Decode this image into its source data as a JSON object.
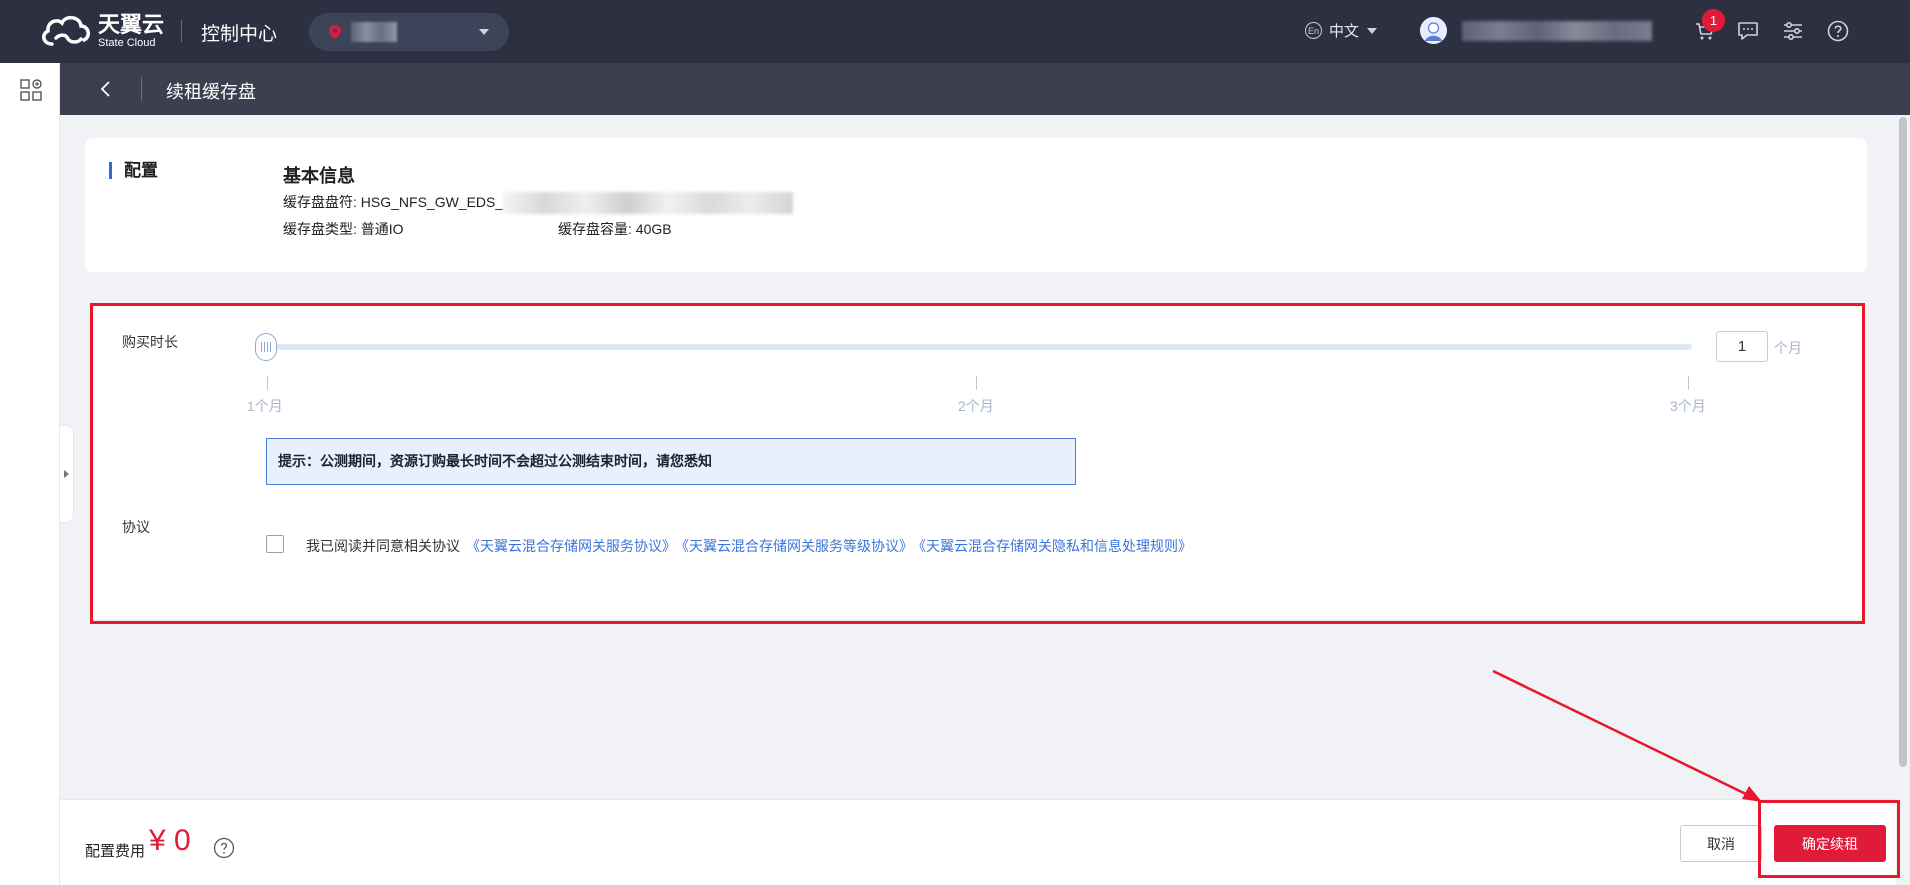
{
  "topbar": {
    "logo_cn": "天翼云",
    "logo_en": "State Cloud",
    "console_title": "控制中心",
    "language": "中文",
    "language_badge": "En",
    "cart_badge": "1"
  },
  "subbar": {
    "title": "续租缓存盘"
  },
  "config": {
    "section_title": "配置",
    "basic_title": "基本信息",
    "disk_id_label": "缓存盘盘符:",
    "disk_id_value": "HSG_NFS_GW_EDS_",
    "disk_type_label": "缓存盘类型:",
    "disk_type_value": "普通IO",
    "disk_capacity_label": "缓存盘容量:",
    "disk_capacity_value": "40GB"
  },
  "purchase": {
    "duration_label": "购买时长",
    "ticks": [
      "1个月",
      "2个月",
      "3个月"
    ],
    "duration_value": "1",
    "duration_unit": "个月",
    "tip": "提示：公测期间，资源订购最长时间不会超过公测结束时间，请您悉知",
    "agreement_label": "协议",
    "agreement_text": "我已阅读并同意相关协议",
    "agreement_links": [
      "《天翼云混合存储网关服务协议》",
      "《天翼云混合存储网关服务等级协议》",
      "《天翼云混合存储网关隐私和信息处理规则》"
    ]
  },
  "footer": {
    "fee_label": "配置费用",
    "fee_value": "¥ 0",
    "cancel_label": "取消",
    "confirm_label": "确定续租"
  },
  "colors": {
    "accent_red": "#e01b3a",
    "link_blue": "#3c75d9",
    "topbar_bg": "#2c3040",
    "annotation_red": "#e8172c"
  }
}
